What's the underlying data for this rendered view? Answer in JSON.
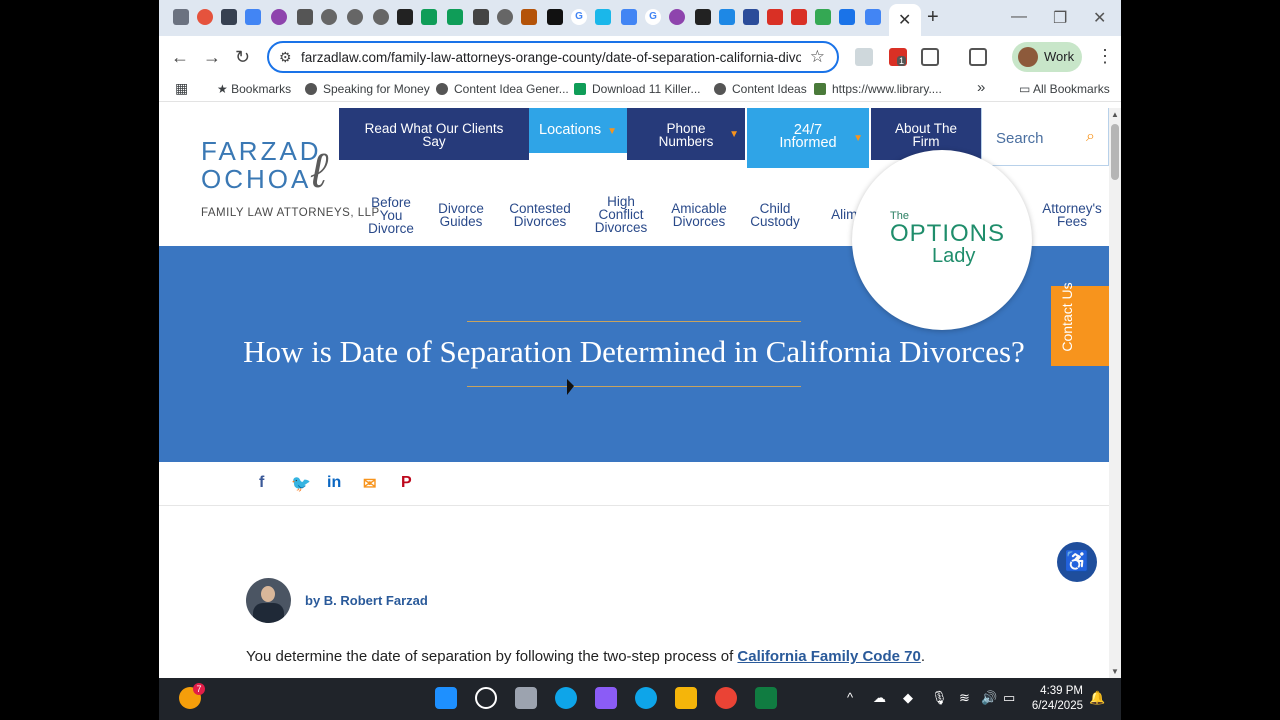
{
  "browser": {
    "url": "farzadlaw.com/family-law-attorneys-orange-county/date-of-separation-california-divor...",
    "profile_label": "Work",
    "tab_close_glyph": "✕",
    "new_tab_glyph": "+",
    "extension_badge": "1"
  },
  "bookmarks": {
    "items": [
      {
        "label": "Bookmarks",
        "icon": "star-icon"
      },
      {
        "label": "Speaking for Money",
        "icon": "globe-icon"
      },
      {
        "label": "Content Idea Gener...",
        "icon": "globe-icon"
      },
      {
        "label": "Download 11 Killer...",
        "icon": "chart-icon"
      },
      {
        "label": "Content Ideas",
        "icon": "globe-icon"
      },
      {
        "label": "https://www.library....",
        "icon": "library-icon"
      }
    ],
    "overflow": "»",
    "all_bookmarks": "All Bookmarks"
  },
  "site": {
    "logo": {
      "line1": "FARZAD",
      "line2": "OCHOA",
      "line3": "FAMILY LAW ATTORNEYS, LLP"
    },
    "top_nav": [
      {
        "label": "Read What Our Clients Say"
      },
      {
        "label": "Locations"
      },
      {
        "label": "Phone Numbers"
      },
      {
        "label": "24/7 Informed"
      },
      {
        "label": "About The Firm"
      }
    ],
    "search_placeholder": "Search",
    "sub_nav": [
      {
        "label": "Before You Divorce"
      },
      {
        "label": "Divorce Guides"
      },
      {
        "label": "Contested Divorces"
      },
      {
        "label": "High Conflict Divorces"
      },
      {
        "label": "Amicable Divorces"
      },
      {
        "label": "Child Custody"
      },
      {
        "label": "Alimo"
      },
      {
        "label": "Attorney's Fees"
      }
    ],
    "options_lady": {
      "the": "The",
      "options": "OPTIONS",
      "lady": "Lady"
    },
    "hero_title": "How is Date of Separation Determined in California Divorces?",
    "contact": "Contact Us",
    "author": "by B. Robert Farzad",
    "body_prefix": "You determine the date of separation by following the two-step process of ",
    "body_link": "California Family Code 70",
    "body_suffix": "."
  },
  "taskbar": {
    "time": "4:39 PM",
    "date": "6/24/2025",
    "notification_badge": "7"
  },
  "colors": {
    "navy": "#263a7a",
    "sky": "#2fa4e7",
    "hero": "#3a76c1",
    "orange": "#f7941d"
  }
}
